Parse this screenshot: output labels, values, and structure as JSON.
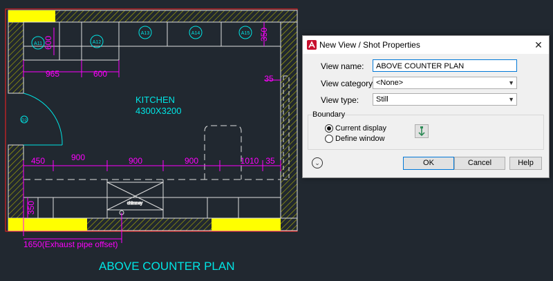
{
  "drawing": {
    "plan_title": "ABOVE COUNTER PLAN",
    "room_name": "KITCHEN",
    "room_size": "4300X3200",
    "cabinet_tags": [
      "A11",
      "A12",
      "A13",
      "A14",
      "A15"
    ],
    "door_tag": "D2",
    "appliance_label": "chimney",
    "dims": {
      "cab_600_v": "600",
      "dim_965": "965",
      "dim_600": "600",
      "dim_350_top": "350",
      "dim_35_a": "35",
      "dim_450": "450",
      "dim_900_a": "900",
      "dim_900_b": "900",
      "dim_900_c": "900",
      "dim_1010": "1010",
      "dim_35_b": "35",
      "dim_350_bottom": "350",
      "exhaust": "1650(Exhaust pipe offset)"
    },
    "colors": {
      "background": "#212830",
      "wall": "#e0e0e0",
      "hatch": "#b5b500",
      "dimension": "#ff00ff",
      "text": "#00e5e5",
      "column": "#ffff00",
      "boundary": "#ff2020"
    }
  },
  "dialog": {
    "title": "New View / Shot Properties",
    "close_glyph": "✕",
    "view_name_label": "View name:",
    "view_name_value": "ABOVE COUNTER PLAN",
    "view_category_label": "View category:",
    "view_category_value": "<None>",
    "view_type_label": "View type:",
    "view_type_value": "Still",
    "boundary_label": "Boundary",
    "current_display_label": "Current display",
    "define_window_label": "Define window",
    "ok_label": "OK",
    "cancel_label": "Cancel",
    "help_label": "Help",
    "selected_boundary": "current_display"
  }
}
